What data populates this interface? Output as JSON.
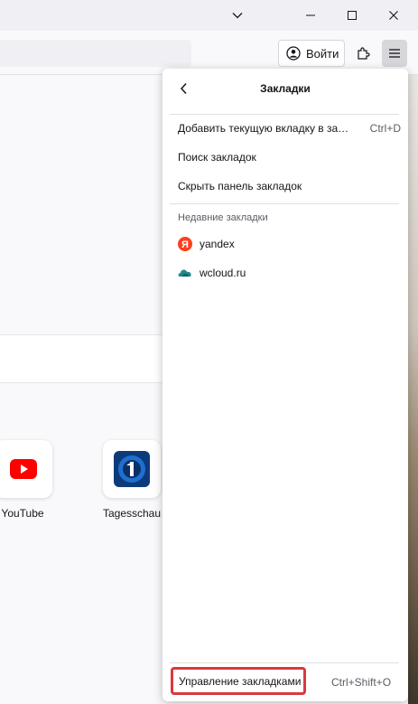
{
  "toolbar": {
    "account_label": "Войти"
  },
  "topsites": [
    {
      "label": "YouTube",
      "icon": "youtube-icon",
      "color": "#ff0000"
    },
    {
      "label": "Tagesschau",
      "icon": "tagesschau-icon",
      "color": "#1a5fb4"
    }
  ],
  "panel": {
    "title": "Закладки",
    "items": [
      {
        "label": "Добавить текущую вкладку в закладки",
        "shortcut": "Ctrl+D"
      },
      {
        "label": "Поиск закладок",
        "shortcut": ""
      },
      {
        "label": "Скрыть панель закладок",
        "shortcut": ""
      }
    ],
    "recent_label": "Недавние закладки",
    "recent": [
      {
        "label": "yandex",
        "icon": "yandex-icon",
        "color": "#fc3f1d"
      },
      {
        "label": "wcloud.ru",
        "icon": "wcloud-icon",
        "color": "#1d8a8a"
      }
    ],
    "manage": {
      "label": "Управление закладками",
      "shortcut": "Ctrl+Shift+O",
      "highlight": "#d9393f"
    }
  }
}
